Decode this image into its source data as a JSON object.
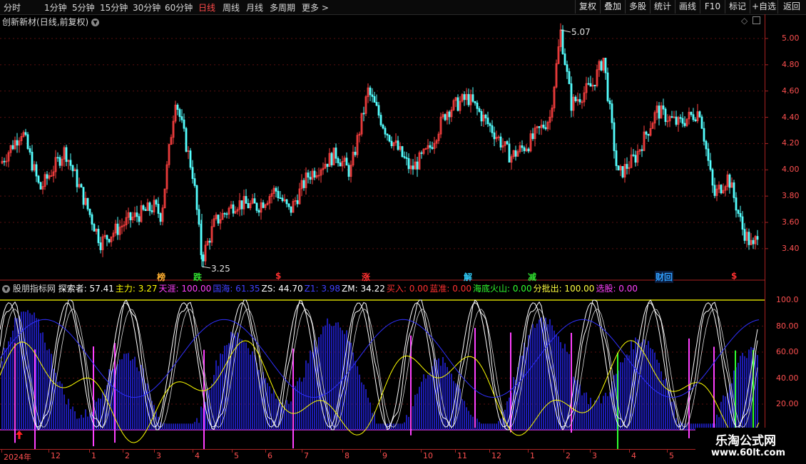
{
  "toolbar": {
    "periods": [
      "分时",
      "1分钟",
      "5分钟",
      "15分钟",
      "30分钟",
      "60分钟",
      "日线",
      "周线",
      "月线",
      "多周期",
      "更多"
    ],
    "active_period": "日线",
    "buttons": [
      "复权",
      "叠加",
      "多股",
      "统计",
      "画线",
      "F10",
      "标记",
      "+自选",
      "返回"
    ]
  },
  "stock": {
    "name": "创新新材",
    "mode": "(日线,前复权)"
  },
  "price_chart": {
    "high_label": "5.07",
    "low_label": "3.25",
    "y_ticks": [
      "5.00",
      "4.80",
      "4.60",
      "4.40",
      "4.20",
      "4.00",
      "3.80",
      "3.60",
      "3.40"
    ]
  },
  "events": [
    {
      "text": "榜",
      "color": "#ffb030"
    },
    {
      "text": "跌",
      "color": "#30e030"
    },
    {
      "text": "$",
      "color": "#ff3030"
    },
    {
      "text": "涨",
      "color": "#ff3030"
    },
    {
      "text": "解",
      "color": "#30d0ff"
    },
    {
      "text": "减",
      "color": "#30e030"
    },
    {
      "text": "财回",
      "color": "#30a0ff"
    },
    {
      "text": "$",
      "color": "#ff3030"
    }
  ],
  "indicator": {
    "name": "股朋指标网",
    "values": [
      {
        "label": "探索者",
        "value": "57.41",
        "color": "#ffffff"
      },
      {
        "label": "主力",
        "value": "3.27",
        "color": "#ffff00"
      },
      {
        "label": "天涯",
        "value": "100.00",
        "color": "#ff40ff"
      },
      {
        "label": "国海",
        "value": "61.35",
        "color": "#4040ff"
      },
      {
        "label": "ZS",
        "value": "44.70",
        "color": "#ffffff"
      },
      {
        "label": "Z1",
        "value": "3.98",
        "color": "#4040ff"
      },
      {
        "label": "ZM",
        "value": "34.22",
        "color": "#ffffff"
      },
      {
        "label": "买入",
        "value": "0.00",
        "color": "#ff3030"
      },
      {
        "label": "蓝准",
        "value": "0.00",
        "color": "#ff3030"
      },
      {
        "label": "海底火山",
        "value": "0.00",
        "color": "#30ff30"
      },
      {
        "label": "分批出",
        "value": "100.00",
        "color": "#ffff40"
      },
      {
        "label": "选股",
        "value": "0.00",
        "color": "#ff40ff"
      }
    ],
    "y_ticks": [
      "100.0",
      "80.00",
      "60.00",
      "40.00",
      "20.00"
    ]
  },
  "date_labels": [
    "2024年",
    "12",
    "1",
    "2",
    "3",
    "4",
    "5",
    "6",
    "7",
    "8",
    "9",
    "10",
    "11",
    "12",
    "1",
    "2",
    "3",
    "4",
    "5"
  ],
  "logo": {
    "title": "乐淘公式网",
    "url": "www.60lt.com"
  },
  "colors": {
    "up": "#ff4040",
    "down": "#54ffff",
    "axis": "#aa2222",
    "volume": "#1c1cb0"
  }
}
